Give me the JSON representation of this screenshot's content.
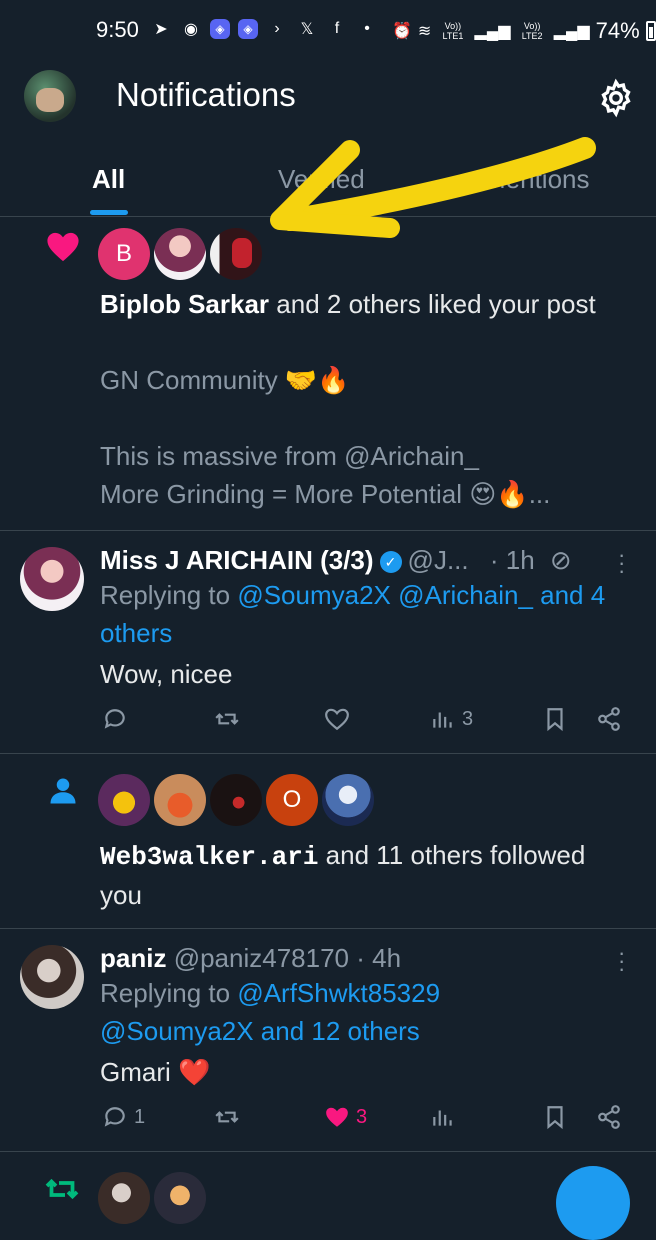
{
  "status": {
    "time": "9:50",
    "battery": "74%",
    "lte1": "Vo)) LTE1",
    "lte2": "Vo)) LTE2"
  },
  "header": {
    "title": "Notifications"
  },
  "tabs": [
    {
      "label": "All"
    },
    {
      "label": "Verified"
    },
    {
      "label": "Mentions"
    }
  ],
  "notif_like": {
    "actor": "Biplob Sarkar",
    "action": " and 2 others liked your post",
    "avatar_letter": "B",
    "line1": "GN Community 🤝🔥",
    "line2": "This is massive from @Arichain_",
    "line3": "More Grinding = More Potential 😍🔥..."
  },
  "post1": {
    "name": "Miss J ARICHAIN (3/3)",
    "handle": "@J...",
    "time": "· 1h",
    "replying_prefix": "Replying to ",
    "replying_links": "@Soumya2X @Arichain_ and 4 others",
    "body": "Wow, nicee",
    "views": "3"
  },
  "notif_follow": {
    "actor": "Web3walker.ari",
    "action": " and 11 others followed you",
    "avatar_letter": "O"
  },
  "post2": {
    "name": "paniz",
    "handle": "@paniz478170",
    "time": "· 4h",
    "replying_prefix": "Replying to ",
    "replying_line1": "@ArfShwkt85329",
    "replying_line2": "@Soumya2X and 12 others",
    "body": "Gmari ❤️",
    "replies": "1",
    "likes": "3"
  },
  "colors": {
    "accent": "#1d9bf0",
    "like": "#f91880",
    "background": "#15202b",
    "arrow": "#f5d30f"
  }
}
